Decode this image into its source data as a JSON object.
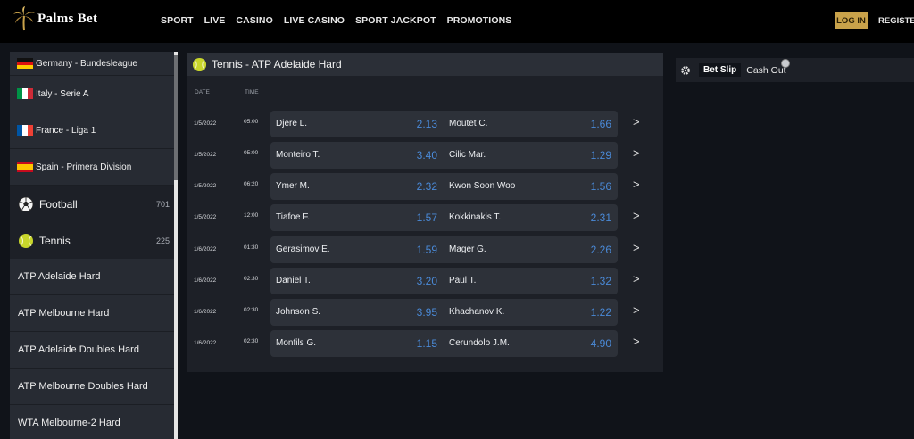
{
  "header": {
    "logo_text": "Palms Bet",
    "nav": [
      "SPORT",
      "LIVE",
      "CASINO",
      "LIVE CASINO",
      "SPORT JACKPOT",
      "PROMOTIONS"
    ],
    "login_label": "LOG IN",
    "register_label": "REGISTER"
  },
  "sidebar": {
    "leagues": [
      {
        "label": "Germany - Bundesleague",
        "flag": "germany"
      },
      {
        "label": "Italy - Serie A",
        "flag": "italy"
      },
      {
        "label": "France - Liga 1",
        "flag": "france"
      },
      {
        "label": "Spain - Primera Division",
        "flag": "spain"
      }
    ],
    "sports": [
      {
        "label": "Football",
        "count": "701",
        "icon": "football-icon"
      },
      {
        "label": "Tennis",
        "count": "225",
        "icon": "tennis-ball-icon"
      }
    ],
    "tournaments": [
      "ATP Adelaide Hard",
      "ATP Melbourne Hard",
      "ATP Adelaide Doubles Hard",
      "ATP Melbourne Doubles Hard",
      "WTA Melbourne-2 Hard"
    ]
  },
  "main": {
    "title": "Tennis - ATP Adelaide Hard",
    "col_date": "DATE",
    "col_time": "TIME",
    "matches": [
      {
        "date": "1/5/2022",
        "time": "05:00",
        "p1": "Djere L.",
        "o1": "2.13",
        "p2": "Moutet C.",
        "o2": "1.66"
      },
      {
        "date": "1/5/2022",
        "time": "05:00",
        "p1": "Monteiro T.",
        "o1": "3.40",
        "p2": "Cilic Mar.",
        "o2": "1.29"
      },
      {
        "date": "1/5/2022",
        "time": "06:20",
        "p1": "Ymer M.",
        "o1": "2.32",
        "p2": "Kwon Soon Woo",
        "o2": "1.56"
      },
      {
        "date": "1/5/2022",
        "time": "12:00",
        "p1": "Tiafoe F.",
        "o1": "1.57",
        "p2": "Kokkinakis T.",
        "o2": "2.31"
      },
      {
        "date": "1/6/2022",
        "time": "01:30",
        "p1": "Gerasimov E.",
        "o1": "1.59",
        "p2": "Mager G.",
        "o2": "2.26"
      },
      {
        "date": "1/6/2022",
        "time": "02:30",
        "p1": "Daniel T.",
        "o1": "3.20",
        "p2": "Paul T.",
        "o2": "1.32"
      },
      {
        "date": "1/6/2022",
        "time": "02:30",
        "p1": "Johnson S.",
        "o1": "3.95",
        "p2": "Khachanov K.",
        "o2": "1.22"
      },
      {
        "date": "1/6/2022",
        "time": "02:30",
        "p1": "Monfils G.",
        "o1": "1.15",
        "p2": "Cerundolo J.M.",
        "o2": "4.90"
      }
    ],
    "row_arrow": ">"
  },
  "betslip": {
    "tab_label": "Bet Slip",
    "cashout_label": "Cash Out"
  },
  "colors": {
    "gold": "#c9a24a",
    "odds": "#4a8ad8",
    "panel": "#1d2027"
  }
}
